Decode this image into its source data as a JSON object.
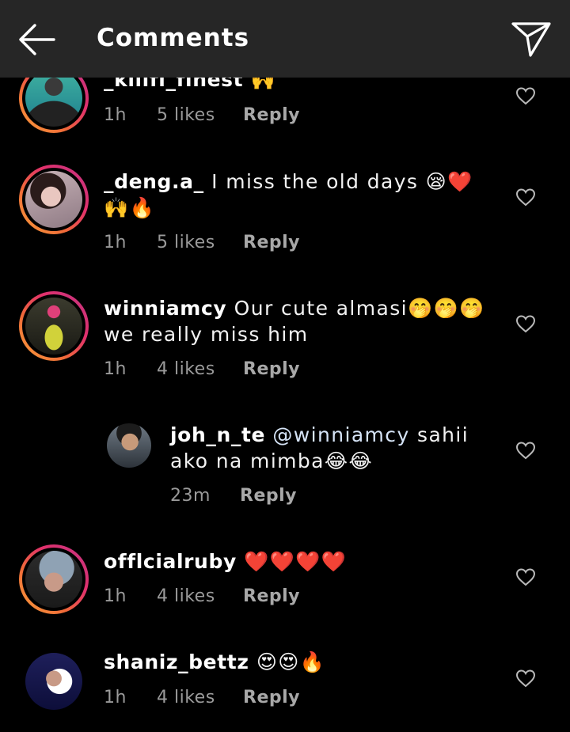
{
  "header": {
    "title": "Comments"
  },
  "comments": [
    {
      "username": "_kilifi_finest",
      "text": "🙌",
      "time": "1h",
      "likes": "5 likes",
      "reply": "Reply"
    },
    {
      "username": "_deng.a_",
      "text": "I miss the old days 😪❤️🙌🔥",
      "time": "1h",
      "likes": "5 likes",
      "reply": "Reply"
    },
    {
      "username": "winniamcy",
      "text": "Our cute almasi🤭🤭🤭we really miss him",
      "time": "1h",
      "likes": "4 likes",
      "reply": "Reply"
    },
    {
      "username": "joh_n_te",
      "mention": "@winniamcy",
      "text": "sahii ako na mimba😂😂",
      "time": "23m",
      "reply": "Reply"
    },
    {
      "username": "offlcialruby",
      "text": "❤️❤️❤️❤️",
      "time": "1h",
      "likes": "4 likes",
      "reply": "Reply"
    },
    {
      "username": "shaniz_bettz",
      "text": "😍😍🔥",
      "time": "1h",
      "likes": "4 likes",
      "reply": "Reply"
    }
  ],
  "icons": {
    "back": "arrow-left-icon",
    "send": "paper-plane-icon",
    "like": "heart-outline-icon"
  },
  "colors": {
    "header_bg": "#262626",
    "background": "#000000",
    "story_ring_start": "#f9a13a",
    "story_ring_end": "#c13584",
    "meta_text": "#9a9a9a"
  }
}
